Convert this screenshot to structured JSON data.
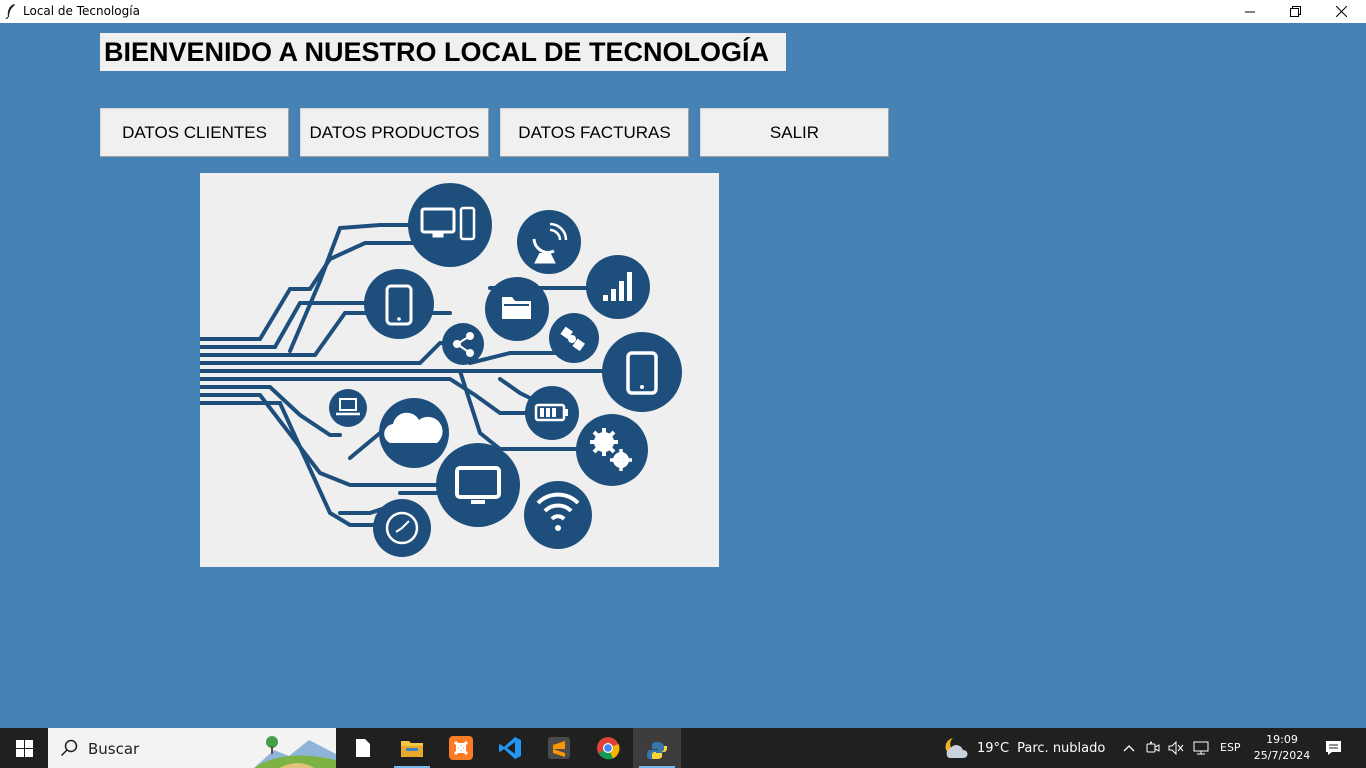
{
  "window": {
    "title": "Local de Tecnología",
    "controls": [
      "minimize-icon",
      "restore-icon",
      "close-icon"
    ]
  },
  "main": {
    "heading": "BIENVENIDO A NUESTRO LOCAL DE TECNOLOGÍA",
    "buttons": [
      {
        "label": "DATOS CLIENTES"
      },
      {
        "label": "DATOS PRODUCTOS"
      },
      {
        "label": "DATOS FACTURAS"
      },
      {
        "label": "SALIR"
      }
    ],
    "illustration": {
      "icons": [
        "desktop-computer-icon",
        "satellite-dish-icon",
        "signal-bars-icon",
        "smartphone-icon",
        "folder-icon",
        "share-icon",
        "satellite-icon",
        "tablet-icon",
        "laptop-icon",
        "cloud-icon",
        "battery-icon",
        "gears-icon",
        "monitor-icon",
        "wifi-icon",
        "clock-icon"
      ],
      "colors": {
        "circle": "#1e4f7c",
        "background": "#efefef"
      }
    }
  },
  "colors": {
    "background": "#4682b4",
    "button_face": "#f0f0f0",
    "taskbar": "#202020"
  },
  "taskbar": {
    "search_placeholder": "Buscar",
    "apps": [
      "file-icon",
      "file-explorer-icon",
      "xampp-icon",
      "vscode-icon",
      "sublime-text-icon",
      "chrome-icon",
      "python-icon"
    ],
    "weather": {
      "temp": "19°C",
      "desc": "Parc. nublado"
    },
    "language": "ESP",
    "time": "19:09",
    "date": "25/7/2024"
  }
}
